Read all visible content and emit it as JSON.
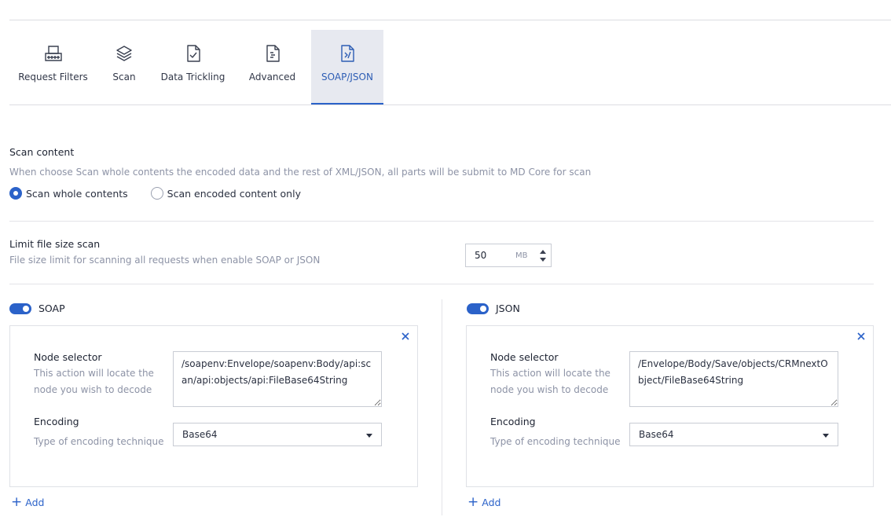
{
  "tabs": [
    {
      "label": "Request Filters",
      "icon": "request-filters-icon"
    },
    {
      "label": "Scan",
      "icon": "layers-icon"
    },
    {
      "label": "Data Trickling",
      "icon": "document-check-icon"
    },
    {
      "label": "Advanced",
      "icon": "document-list-icon"
    },
    {
      "label": "SOAP/JSON",
      "icon": "document-code-icon",
      "active": true
    }
  ],
  "scan_content": {
    "title": "Scan content",
    "description": "When choose Scan whole contents the encoded data and the rest of XML/JSON, all parts will be submit to MD Core for scan",
    "options": [
      {
        "label": "Scan whole contents",
        "checked": true
      },
      {
        "label": "Scan encoded content only",
        "checked": false
      }
    ]
  },
  "limit": {
    "title": "Limit file size scan",
    "description": "File size limit for scanning all requests when enable SOAP or JSON",
    "value": "50",
    "unit": "MB"
  },
  "soap": {
    "label": "SOAP",
    "enabled": true,
    "node_selector_label": "Node selector",
    "node_selector_desc": "This action will locate the node you wish to decode",
    "node_selector_value": "/soapenv:Envelope/soapenv:Body/api:scan/api:objects/api:FileBase64String",
    "encoding_label": "Encoding",
    "encoding_desc": "Type of encoding technique",
    "encoding_value": "Base64",
    "add_label": "Add"
  },
  "json": {
    "label": "JSON",
    "enabled": true,
    "node_selector_label": "Node selector",
    "node_selector_desc": "This action will locate the node you wish to decode",
    "node_selector_value": "/Envelope/Body/Save/objects/CRMnextObject/FileBase64String",
    "encoding_label": "Encoding",
    "encoding_desc": "Type of encoding technique",
    "encoding_value": "Base64",
    "add_label": "Add"
  },
  "colors": {
    "accent": "#2b62c9",
    "active_tab_bg": "#e7e9f0",
    "muted_text": "#8d93a6"
  }
}
